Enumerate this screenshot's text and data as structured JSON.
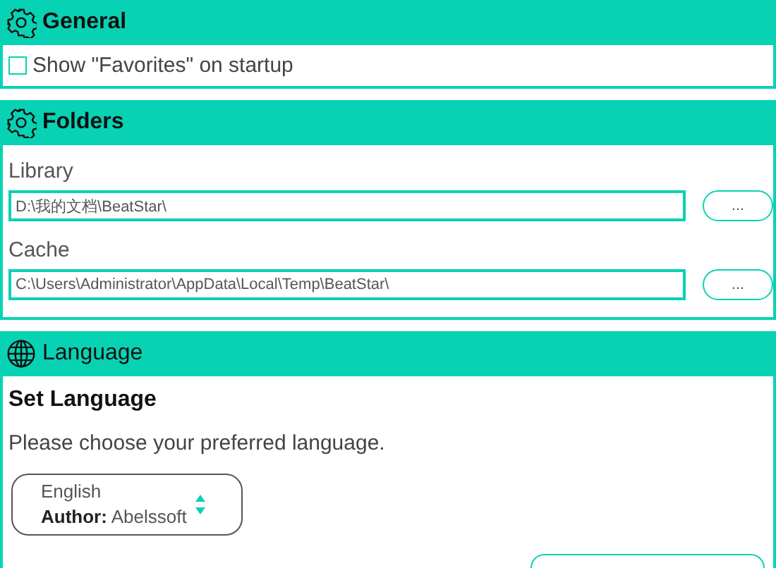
{
  "sections": [
    {
      "kind": "general",
      "title": "General",
      "checkbox": {
        "label": "Show \"Favorites\" on startup",
        "checked": false
      }
    },
    {
      "kind": "folders",
      "title": "Folders",
      "fields": [
        {
          "label": "Library",
          "value": "D:\\我的文档\\BeatStar\\",
          "button": "..."
        },
        {
          "label": "Cache",
          "value": "C:\\Users\\Administrator\\AppData\\Local\\Temp\\BeatStar\\",
          "button": "..."
        }
      ]
    },
    {
      "kind": "language",
      "title": "Language",
      "heading": "Set Language",
      "description": "Please choose your preferred language.",
      "select": {
        "value": "English",
        "author_label": "Author:",
        "author": "Abelssoft"
      }
    }
  ]
}
